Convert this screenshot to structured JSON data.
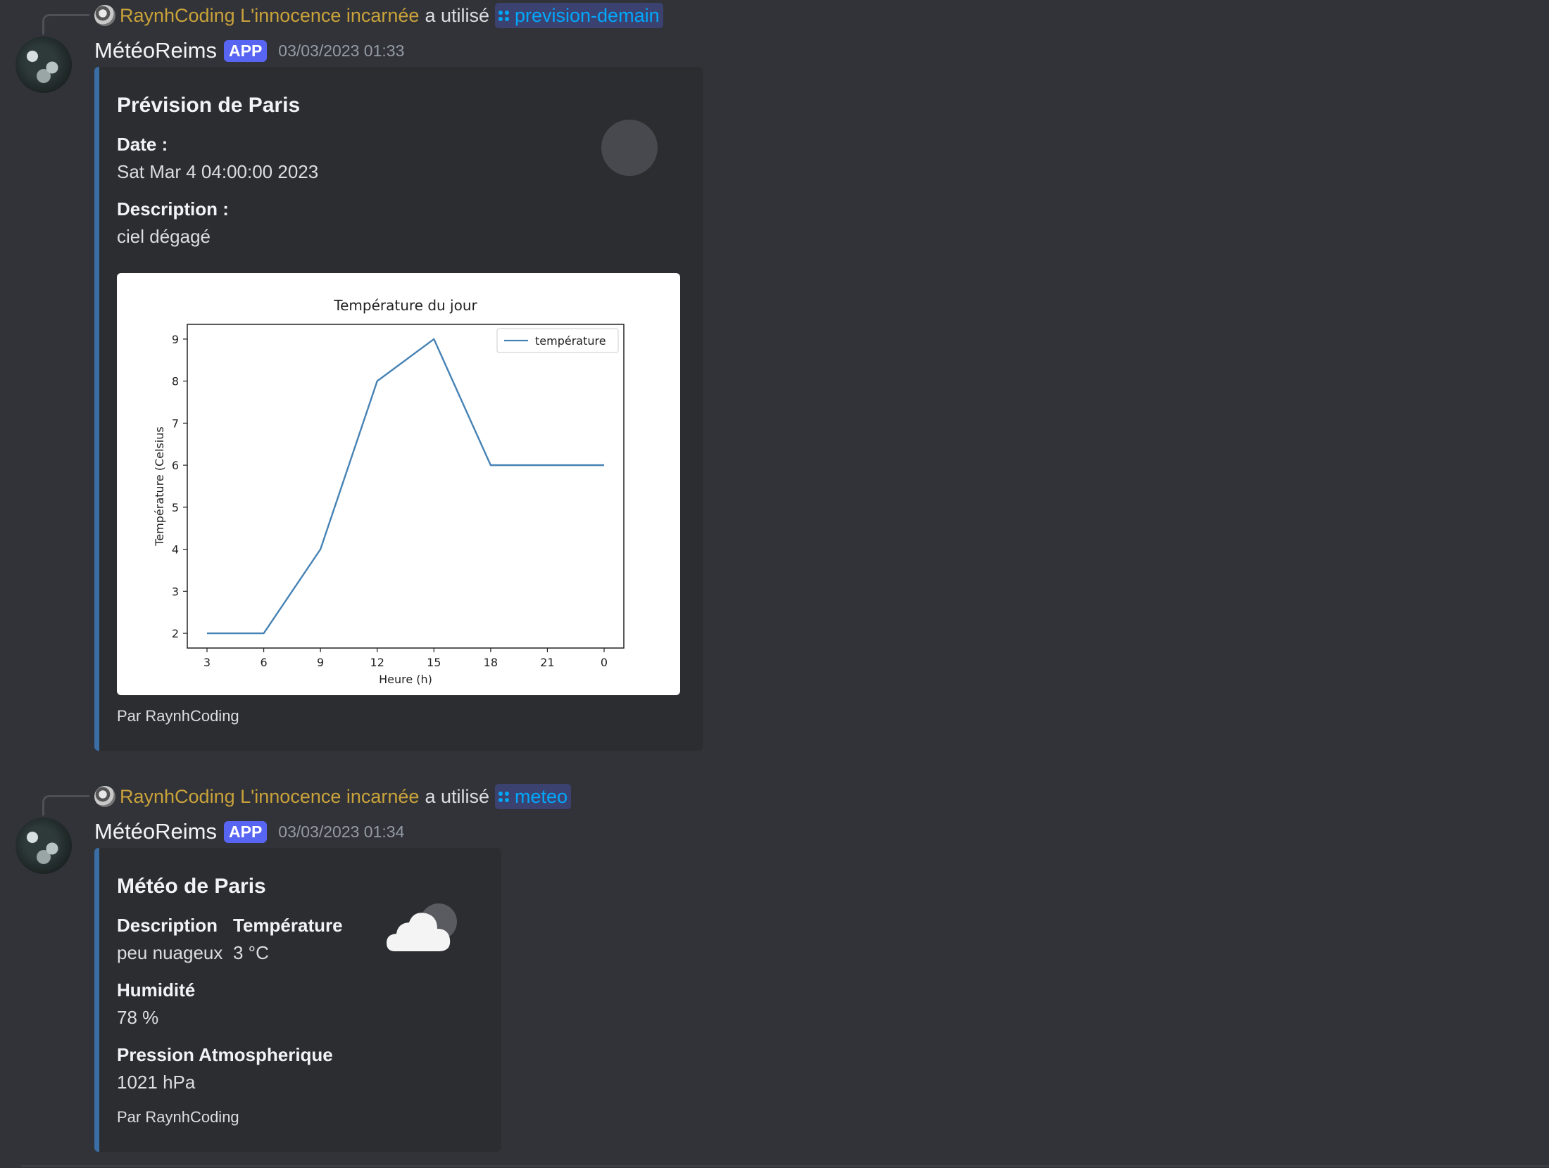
{
  "messages": [
    {
      "reply": {
        "user": "RaynhCoding L'innocence incarnée",
        "used_text": "a utilisé",
        "command": "prevision-demain"
      },
      "bot": {
        "name": "MétéoReims",
        "badge": "APP",
        "timestamp": "03/03/2023 01:33"
      },
      "embed": {
        "title": "Prévision de Paris",
        "fields": [
          {
            "name": "Date :",
            "value": "Sat Mar 4 04:00:00 2023"
          },
          {
            "name": "Description :",
            "value": "ciel dégagé"
          }
        ],
        "footer": "Par RaynhCoding"
      }
    },
    {
      "reply": {
        "user": "RaynhCoding L'innocence incarnée",
        "used_text": "a utilisé",
        "command": "meteo"
      },
      "bot": {
        "name": "MétéoReims",
        "badge": "APP",
        "timestamp": "03/03/2023 01:34"
      },
      "embed": {
        "title": "Météo de Paris",
        "fields": [
          {
            "name": "Description",
            "value": "peu nuageux"
          },
          {
            "name": "Température",
            "value": "3 °C"
          },
          {
            "name": "Humidité",
            "value": "78 %"
          },
          {
            "name": "Pression Atmospherique",
            "value": "1021 hPa"
          }
        ],
        "footer": "Par RaynhCoding",
        "thumbnail_icon": "cloud-icon"
      }
    }
  ],
  "chart_data": {
    "type": "line",
    "title": "Température du jour",
    "xlabel": "Heure (h)",
    "ylabel": "Température (Celsius",
    "categories": [
      "3",
      "6",
      "9",
      "12",
      "15",
      "18",
      "21",
      "0"
    ],
    "series": [
      {
        "name": "température",
        "values": [
          2,
          2,
          4,
          8,
          9,
          6,
          6,
          6
        ],
        "color": "#4682b4"
      }
    ],
    "yticks": [
      2,
      3,
      4,
      5,
      6,
      7,
      8,
      9
    ],
    "ylim": [
      1.65,
      9.35
    ],
    "legend": "top-right",
    "grid": false
  },
  "colors": {
    "background": "#313338",
    "embed": "#2b2d31",
    "embed_border": "#3a6ea5",
    "badge": "#5865f2",
    "mention": "#00a8fc",
    "username": "#c9a23a"
  }
}
